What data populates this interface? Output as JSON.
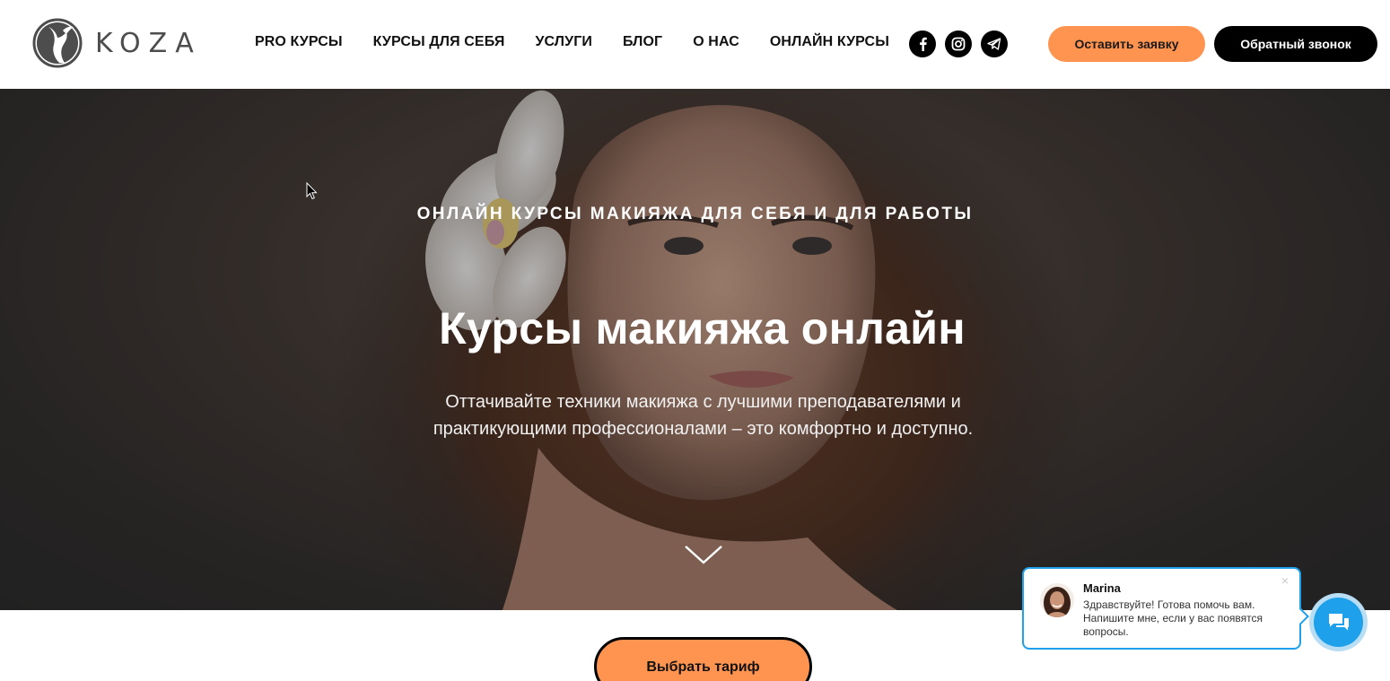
{
  "brand": {
    "name": "KOZA",
    "logo_icon": "goat-head-icon"
  },
  "nav": {
    "items": [
      {
        "label": "PRO КУРСЫ"
      },
      {
        "label": "КУРСЫ ДЛЯ СЕБЯ"
      },
      {
        "label": "УСЛУГИ"
      },
      {
        "label": "БЛОГ"
      },
      {
        "label": "О НАС"
      },
      {
        "label": "ОНЛАЙН КУРСЫ"
      }
    ]
  },
  "socials": [
    {
      "icon": "facebook-icon"
    },
    {
      "icon": "instagram-icon"
    },
    {
      "icon": "telegram-icon"
    }
  ],
  "header_buttons": {
    "request_label": "Оставить заявку",
    "callback_label": "Обратный звонок"
  },
  "hero": {
    "subtitle": "ОНЛАЙН КУРСЫ МАКИЯЖА ДЛЯ СЕБЯ И ДЛЯ РАБОТЫ",
    "title": "Курсы макияжа онлайн",
    "description_line1": "Оттачивайте техники макияжа с лучшими преподавателями и",
    "description_line2": "практикующими профессионалами – это комфортно и доступно.",
    "scroll_icon": "chevron-down-icon"
  },
  "tariff_button": {
    "label": "Выбрать тариф"
  },
  "chat": {
    "agent_name": "Marina",
    "message": "Здравствуйте! Готова помочь вам. Напишите мне, если у вас появятся вопросы.",
    "close_label": "×",
    "launcher_icon": "chat-bubbles-icon"
  },
  "colors": {
    "accent": "#ff9451",
    "dark": "#000000",
    "chat_blue": "#1ea1ea"
  }
}
